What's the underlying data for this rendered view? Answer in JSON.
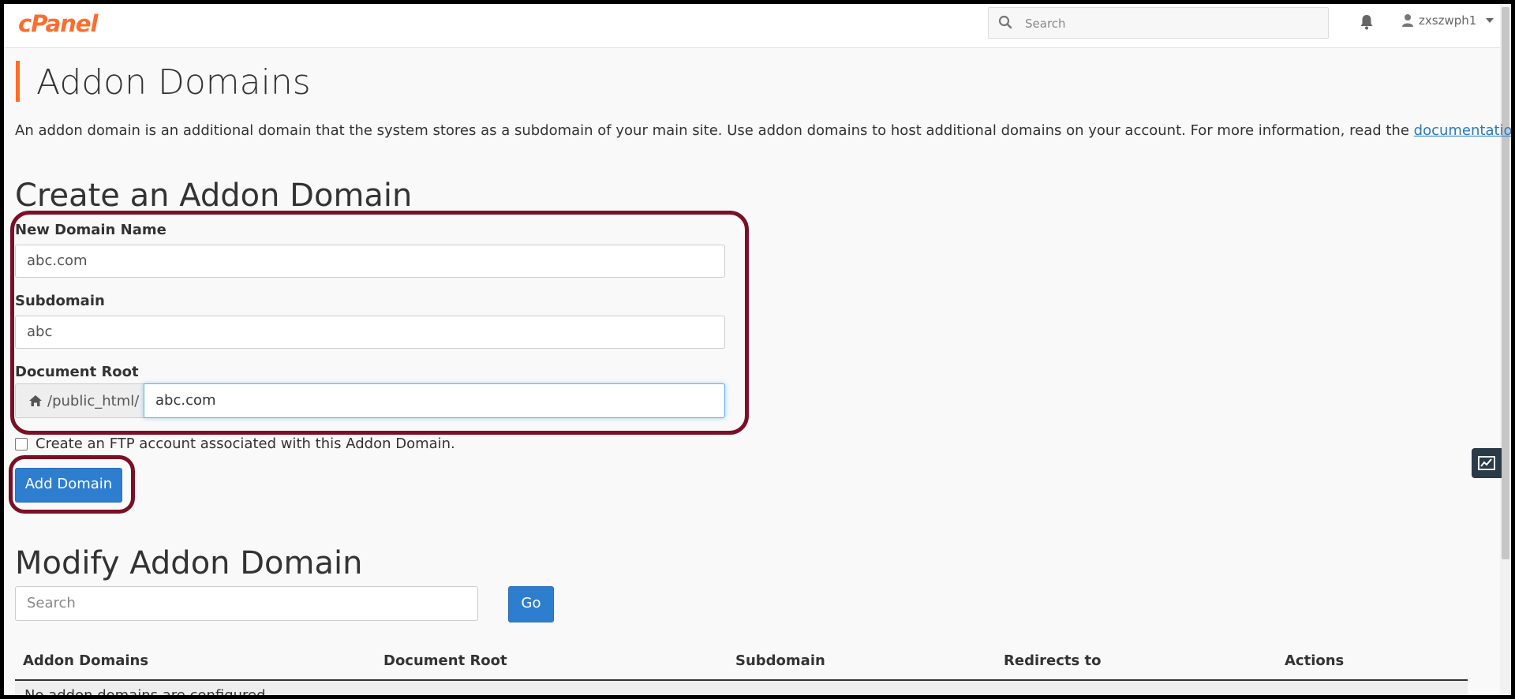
{
  "header": {
    "logo": "cPanel",
    "search_placeholder": "Search",
    "username": "zxszwph1"
  },
  "page": {
    "title": "Addon Domains",
    "description": "An addon domain is an additional domain that the system stores as a subdomain of your main site. Use addon domains to host additional domains on your account. For more information, read the ",
    "description_link": "documentation",
    "description_end": "."
  },
  "create": {
    "heading": "Create an Addon Domain",
    "new_domain_label": "New Domain Name",
    "new_domain_value": "abc.com",
    "subdomain_label": "Subdomain",
    "subdomain_value": "abc",
    "document_root_label": "Document Root",
    "document_root_prefix": "/public_html/",
    "document_root_value": "abc.com",
    "ftp_checkbox_label": "Create an FTP account associated with this Addon Domain.",
    "ftp_checked": false,
    "add_button": "Add Domain"
  },
  "modify": {
    "heading": "Modify Addon Domain",
    "search_placeholder": "Search",
    "go_button": "Go",
    "columns": [
      "Addon Domains",
      "Document Root",
      "Subdomain",
      "Redirects to",
      "Actions"
    ],
    "empty_message": "No addon domains are configured."
  },
  "colors": {
    "brand": "#ff6c2c",
    "primary_button": "#2e7ed0",
    "highlight_ring": "#7a0f25"
  }
}
